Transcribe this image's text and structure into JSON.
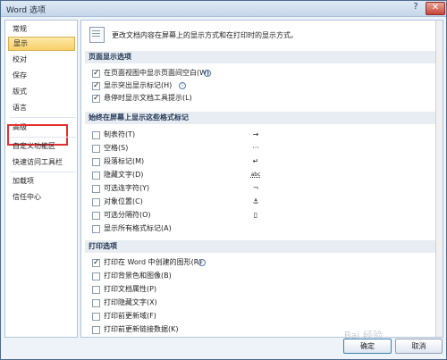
{
  "window": {
    "title": "Word 选项",
    "help": "?",
    "close": "✕"
  },
  "sidebar": {
    "items": [
      {
        "label": "常规",
        "selected": false
      },
      {
        "label": "显示",
        "selected": true
      },
      {
        "label": "校对",
        "selected": false
      },
      {
        "label": "保存",
        "selected": false
      },
      {
        "label": "版式",
        "selected": false
      },
      {
        "label": "语言",
        "selected": false
      },
      {
        "label": "高级",
        "selected": false
      },
      {
        "label": "自定义功能区",
        "selected": false
      },
      {
        "label": "快速访问工具栏",
        "selected": false
      },
      {
        "label": "加载项",
        "selected": false
      },
      {
        "label": "信任中心",
        "selected": false
      }
    ]
  },
  "intro": "更改文档内容在屏幕上的显示方式和在打印时的显示方式。",
  "sections": {
    "page_display": {
      "title": "页面显示选项",
      "options": [
        {
          "label": "在页面视图中显示页面间空白(W)",
          "checked": true,
          "info": "i"
        },
        {
          "label": "显示突出显示标记(H)",
          "checked": true,
          "info": "i"
        },
        {
          "label": "悬停时显示文档工具提示(L)",
          "checked": true
        }
      ]
    },
    "format_marks": {
      "title": "始终在屏幕上显示这些格式标记",
      "options": [
        {
          "label": "制表符(T)",
          "checked": false,
          "glyph": "→"
        },
        {
          "label": "空格(S)",
          "checked": false,
          "glyph": "···"
        },
        {
          "label": "段落标记(M)",
          "checked": false,
          "glyph": "↵"
        },
        {
          "label": "隐藏文字(D)",
          "checked": false,
          "glyph": "abc"
        },
        {
          "label": "可选连字符(Y)",
          "checked": false,
          "glyph": "¬"
        },
        {
          "label": "对象位置(C)",
          "checked": false,
          "glyph": "⚓"
        },
        {
          "label": "可选分隔符(O)",
          "checked": false,
          "glyph": "▯"
        },
        {
          "label": "显示所有格式标记(A)",
          "checked": false
        }
      ]
    },
    "print": {
      "title": "打印选项",
      "options": [
        {
          "label": "打印在 Word 中创建的图形(R)",
          "checked": true,
          "info": "i"
        },
        {
          "label": "打印背景色和图像(B)",
          "checked": false
        },
        {
          "label": "打印文档属性(P)",
          "checked": false
        },
        {
          "label": "打印隐藏文字(X)",
          "checked": false
        },
        {
          "label": "打印前更新域(F)",
          "checked": false
        },
        {
          "label": "打印前更新链接数据(K)",
          "checked": false
        }
      ]
    }
  },
  "buttons": {
    "ok": "确定",
    "cancel": "取消"
  },
  "watermark": "Bai 经验"
}
